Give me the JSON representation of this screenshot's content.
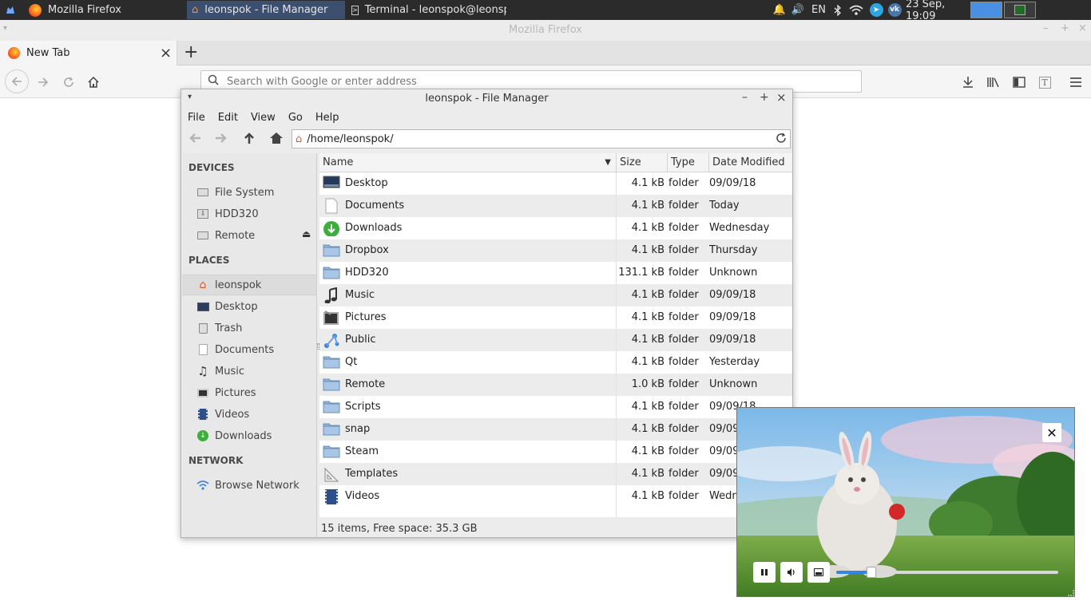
{
  "panel": {
    "tasks": [
      {
        "label": "Mozilla Firefox"
      },
      {
        "label": "leonspok - File Manager"
      },
      {
        "label": "Terminal - leonspok@leonsp..."
      }
    ],
    "keyboard_layout": "EN",
    "clock": "23 Sep, 19:09"
  },
  "firefox": {
    "window_title": "Mozilla Firefox",
    "tab_label": "New Tab",
    "url_placeholder": "Search with Google or enter address"
  },
  "file_manager": {
    "title": "leonspok - File Manager",
    "menu": [
      "File",
      "Edit",
      "View",
      "Go",
      "Help"
    ],
    "path": "/home/leonspok/",
    "sidebar": {
      "devices_header": "DEVICES",
      "devices": [
        {
          "label": "File System",
          "icon": "drive-icon"
        },
        {
          "label": "HDD320",
          "icon": "usb-drive-icon"
        },
        {
          "label": "Remote",
          "icon": "drive-icon"
        }
      ],
      "places_header": "PLACES",
      "places": [
        {
          "label": "leonspok",
          "icon": "home-icon"
        },
        {
          "label": "Desktop",
          "icon": "desktop-icon"
        },
        {
          "label": "Trash",
          "icon": "trash-icon"
        },
        {
          "label": "Documents",
          "icon": "document-icon"
        },
        {
          "label": "Music",
          "icon": "music-icon"
        },
        {
          "label": "Pictures",
          "icon": "pictures-icon"
        },
        {
          "label": "Videos",
          "icon": "video-icon"
        },
        {
          "label": "Downloads",
          "icon": "download-icon"
        }
      ],
      "network_header": "NETWORK",
      "network": [
        {
          "label": "Browse Network",
          "icon": "wifi-icon"
        }
      ]
    },
    "columns": {
      "name": "Name",
      "size": "Size",
      "type": "Type",
      "date": "Date Modified"
    },
    "rows": [
      {
        "name": "Desktop",
        "size": "4.1 kB",
        "type": "folder",
        "date": "09/09/18",
        "icon": "desktop"
      },
      {
        "name": "Documents",
        "size": "4.1 kB",
        "type": "folder",
        "date": "Today",
        "icon": "document"
      },
      {
        "name": "Downloads",
        "size": "4.1 kB",
        "type": "folder",
        "date": "Wednesday",
        "icon": "download"
      },
      {
        "name": "Dropbox",
        "size": "4.1 kB",
        "type": "folder",
        "date": "Thursday",
        "icon": "folder"
      },
      {
        "name": "HDD320",
        "size": "131.1 kB",
        "type": "folder",
        "date": "Unknown",
        "icon": "folder"
      },
      {
        "name": "Music",
        "size": "4.1 kB",
        "type": "folder",
        "date": "09/09/18",
        "icon": "music"
      },
      {
        "name": "Pictures",
        "size": "4.1 kB",
        "type": "folder",
        "date": "09/09/18",
        "icon": "pictures"
      },
      {
        "name": "Public",
        "size": "4.1 kB",
        "type": "folder",
        "date": "09/09/18",
        "icon": "public"
      },
      {
        "name": "Qt",
        "size": "4.1 kB",
        "type": "folder",
        "date": "Yesterday",
        "icon": "folder"
      },
      {
        "name": "Remote",
        "size": "1.0 kB",
        "type": "folder",
        "date": "Unknown",
        "icon": "folder"
      },
      {
        "name": "Scripts",
        "size": "4.1 kB",
        "type": "folder",
        "date": "09/09/18",
        "icon": "folder"
      },
      {
        "name": "snap",
        "size": "4.1 kB",
        "type": "folder",
        "date": "09/09/18",
        "icon": "folder"
      },
      {
        "name": "Steam",
        "size": "4.1 kB",
        "type": "folder",
        "date": "09/09/18",
        "icon": "folder"
      },
      {
        "name": "Templates",
        "size": "4.1 kB",
        "type": "folder",
        "date": "09/09/18",
        "icon": "templates"
      },
      {
        "name": "Videos",
        "size": "4.1 kB",
        "type": "folder",
        "date": "Wednesday",
        "icon": "video"
      }
    ],
    "status": "15 items, Free space: 35.3 GB"
  },
  "video": {
    "progress": 0.16
  },
  "colors": {
    "panel_bg": "#2b2b2b",
    "active_task": "#3c4f6e",
    "folder_blue": "#8fb3d9",
    "accent": "#3584e4"
  }
}
